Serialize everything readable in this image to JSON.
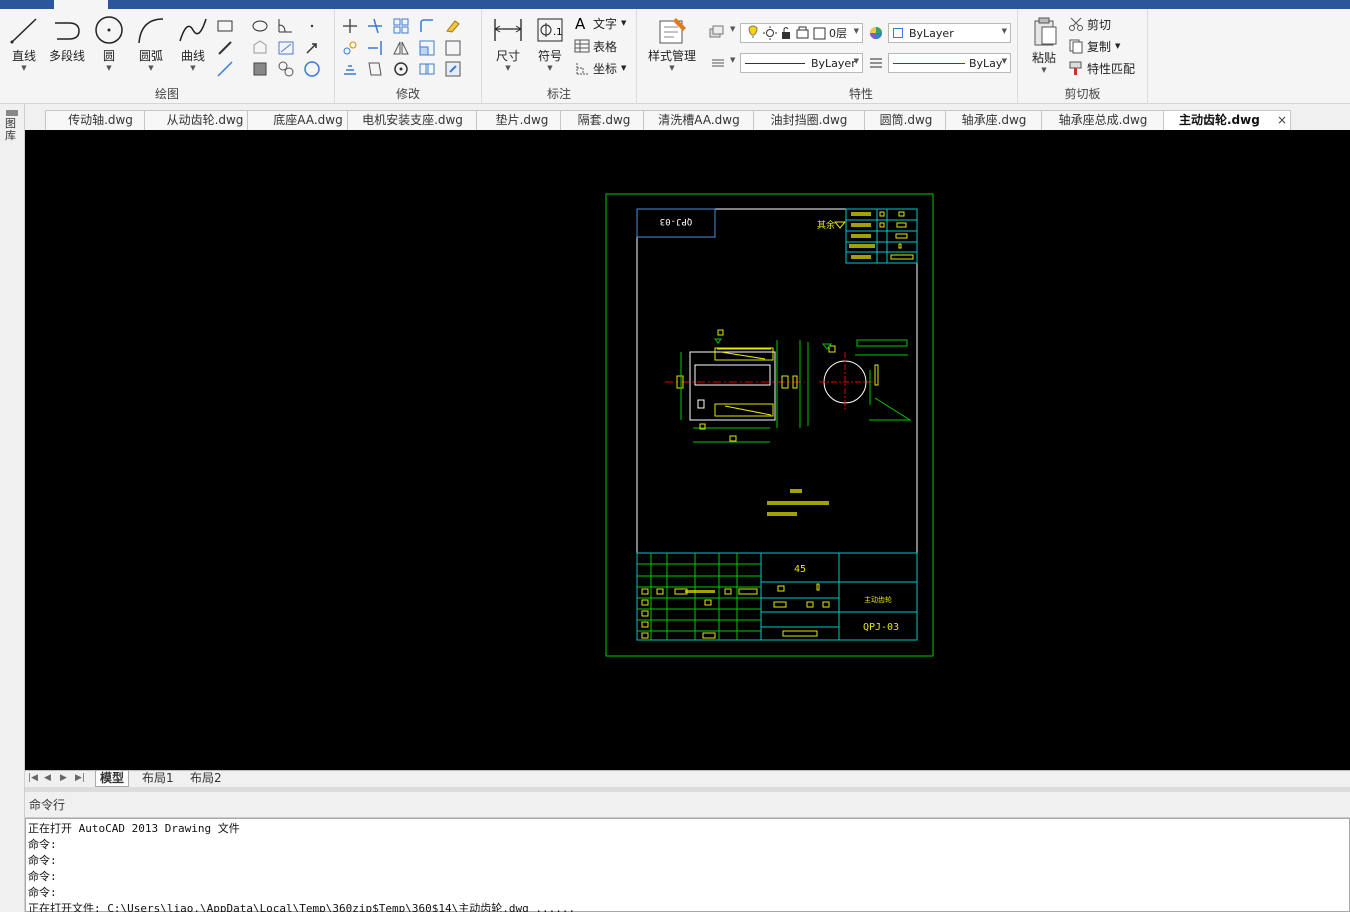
{
  "ribbon": {
    "draw": {
      "title": "绘图",
      "line": "直线",
      "polyline": "多段线",
      "circle": "圆",
      "arc": "圆弧",
      "spline": "曲线"
    },
    "modify": {
      "title": "修改"
    },
    "annotation": {
      "title": "标注",
      "dimension": "尺寸",
      "symbol": "符号",
      "text": "文字",
      "table": "表格",
      "coordinate": "坐标"
    },
    "style": {
      "label": "样式管理"
    },
    "properties": {
      "title": "特性",
      "layer": "0层",
      "color": "ByLayer",
      "linetype": "ByLayer",
      "lineweight": "ByLay"
    },
    "clipboard": {
      "title": "剪切板",
      "paste": "粘贴",
      "cut": "剪切",
      "copy": "复制",
      "match": "特性匹配"
    }
  },
  "left_palette": {
    "label": "图库"
  },
  "doc_tabs": [
    "传动轴.dwg",
    "从动齿轮.dwg",
    "底座AA.dwg",
    "电机安装支座.dwg",
    "垫片.dwg",
    "隔套.dwg",
    "清洗槽AA.dwg",
    "油封挡圈.dwg",
    "圆筒.dwg",
    "轴承座.dwg",
    "轴承座总成.dwg",
    "主动齿轮.dwg"
  ],
  "active_doc_close": "×",
  "drawing": {
    "code_box": "QPJ-03",
    "roughness_note": "其余",
    "material": "45",
    "part_name": "主动齿轮",
    "drawing_no": "QPJ-03"
  },
  "layout_tabs": [
    "模型",
    "布局1",
    "布局2"
  ],
  "command": {
    "title": "命令行",
    "history": [
      "正在打开 AutoCAD 2013 Drawing 文件",
      "命令:",
      "命令:",
      "命令:",
      "命令:",
      "正在打开文件: C:\\Users\\liao.\\AppData\\Local\\Temp\\360zip$Temp\\360$14\\主动齿轮.dwg ......"
    ]
  },
  "colors": {
    "canvas": "#000000",
    "cad_green": "#00c800",
    "cad_cyan": "#00c8c8",
    "cad_yellow": "#e6e600",
    "cad_red": "#e00000",
    "cad_white": "#ffffff",
    "frame_blue": "#4a90d9",
    "ribbon_blue": "#2b579a"
  }
}
